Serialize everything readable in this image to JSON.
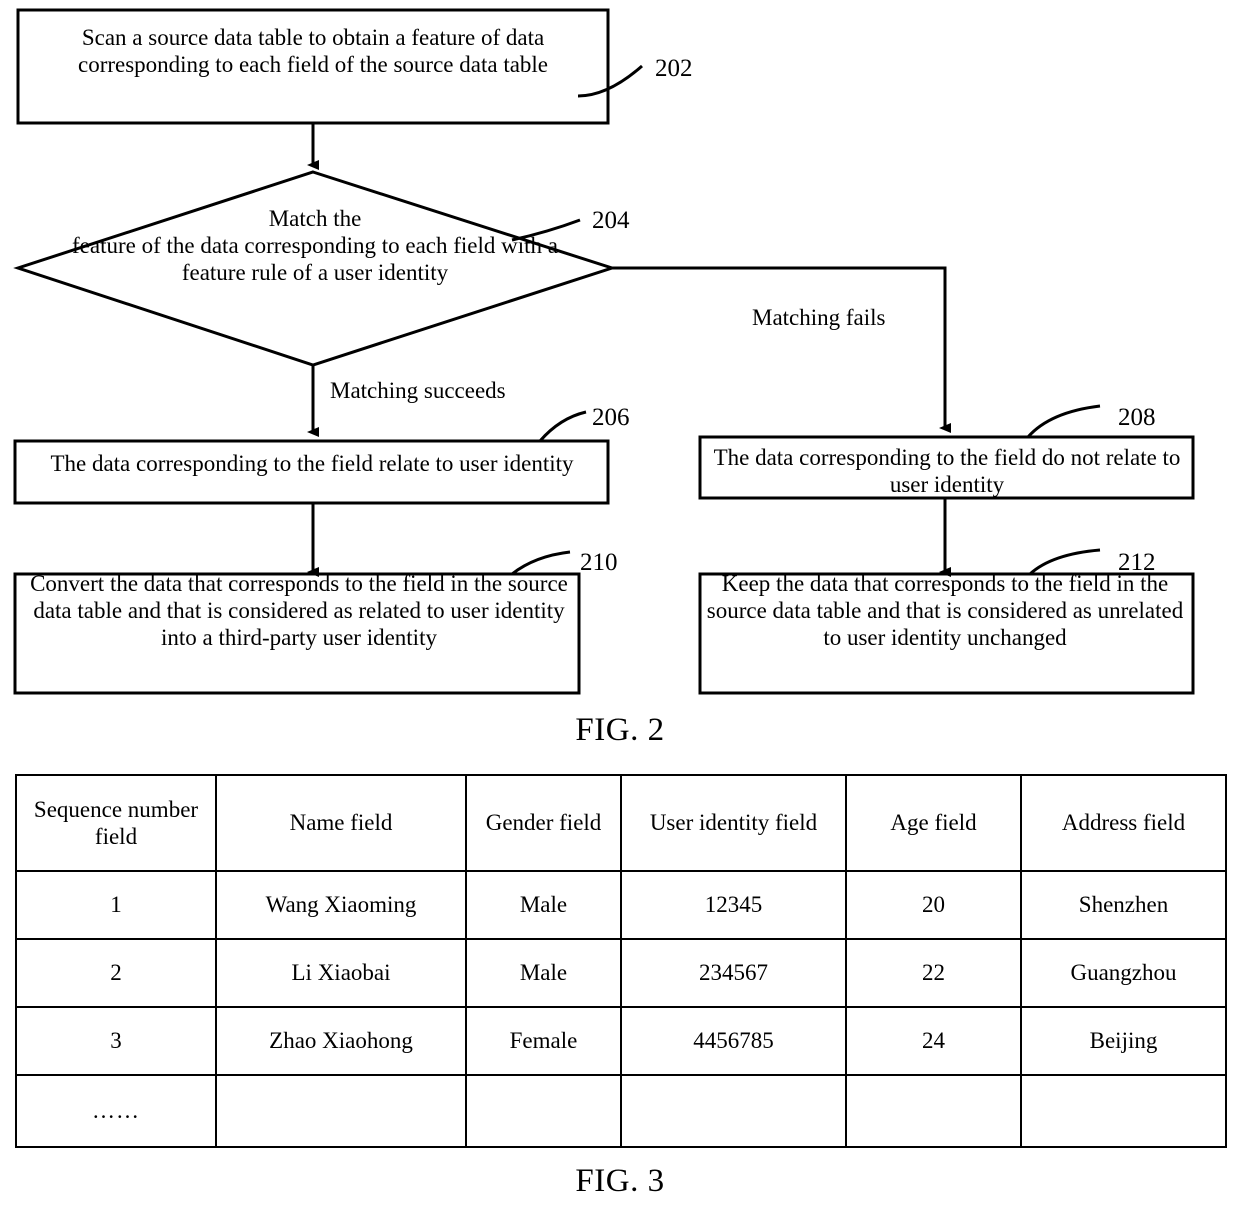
{
  "figure2": {
    "caption": "FIG. 2",
    "nodes": [
      {
        "ref": "202",
        "shape": "rectangle",
        "text": "Scan a source data table to obtain a feature of data corresponding to each field of the source data table"
      },
      {
        "ref": "204",
        "shape": "diamond",
        "text": "Match the\nfeature of the data corresponding to each field with a feature rule of a user identity"
      },
      {
        "ref": "206",
        "shape": "rectangle",
        "text": "The data corresponding to the field relate to user identity"
      },
      {
        "ref": "208",
        "shape": "rectangle",
        "text": "The data corresponding to the field do not relate to user identity"
      },
      {
        "ref": "210",
        "shape": "rectangle",
        "text": "Convert the data that corresponds to the field in the source data table and that is considered as related to user identity into a third-party user identity"
      },
      {
        "ref": "212",
        "shape": "rectangle",
        "text": "Keep the data that corresponds to the field in the source data table and that is considered as unrelated to user identity unchanged"
      }
    ],
    "edge_labels": {
      "succeeds": "Matching succeeds",
      "fails": "Matching fails"
    }
  },
  "figure3": {
    "caption": "FIG. 3",
    "table": {
      "headers": [
        "Sequence number field",
        "Name field",
        "Gender field",
        "User identity field",
        "Age field",
        "Address field"
      ],
      "rows": [
        [
          "1",
          "Wang Xiaoming",
          "Male",
          "12345",
          "20",
          "Shenzhen"
        ],
        [
          "2",
          "Li Xiaobai",
          "Male",
          "234567",
          "22",
          "Guangzhou"
        ],
        [
          "3",
          "Zhao Xiaohong",
          "Female",
          "4456785",
          "24",
          "Beijing"
        ]
      ],
      "ellipsis_row": [
        "……",
        "",
        "",
        "",
        "",
        ""
      ]
    }
  },
  "colors": {
    "stroke": "#000000",
    "background": "#ffffff"
  }
}
